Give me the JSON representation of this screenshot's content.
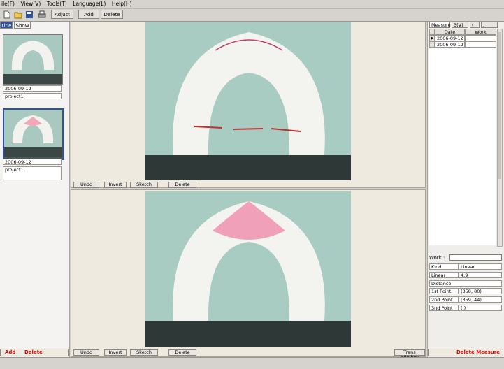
{
  "menu": [
    "ile(F)",
    "View(V)",
    "Tools(T)",
    "Language(L)",
    "Help(H)"
  ],
  "toolbar": {
    "adjust": "Adjust",
    "add": "Add",
    "delete": "Delete"
  },
  "left_panel": {
    "tabs": [
      "Title",
      "Show"
    ],
    "thumbnails": [
      {
        "date": "2006-09-12",
        "name": "project1"
      },
      {
        "date": "2006-09-12",
        "name": "project1"
      }
    ],
    "add_label": "Add",
    "delete_label": "Delete"
  },
  "viewers": [
    {
      "buttons": [
        "Undo",
        "Invert",
        "Sketch",
        "Delete"
      ]
    },
    {
      "buttons": [
        "Undo",
        "Invert",
        "Sketch",
        "Delete"
      ],
      "extra": "Trans Window"
    }
  ],
  "right_panel": {
    "tabs": [
      "Measure",
      "3(V) =",
      "(",
      ","
    ],
    "grid_headers": [
      "Date",
      "Work"
    ],
    "rows": [
      "2006-09-12",
      "2006-09-12"
    ],
    "work_label": "Work :",
    "props": [
      {
        "k": "Kind",
        "v": "Linear"
      },
      {
        "k": "Linear",
        "v": "4.9"
      },
      {
        "k": "Distance",
        "v": ""
      },
      {
        "k": "1st Point",
        "v": "(358, 80)"
      },
      {
        "k": "2nd Point",
        "v": "(359, 44)"
      },
      {
        "k": "3nd Point",
        "v": "(,)"
      }
    ],
    "delete_measure": "Delete Measure"
  },
  "icons": [
    "new-file-icon",
    "open-folder-icon",
    "save-disk-icon",
    "print-icon"
  ]
}
